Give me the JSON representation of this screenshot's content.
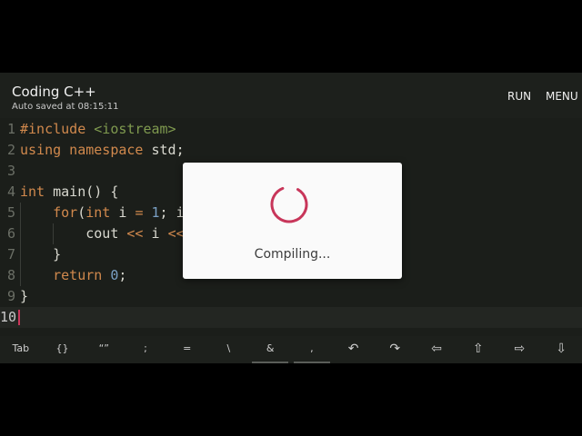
{
  "app": {
    "title": "Coding C++",
    "subtitle": "Auto saved at 08:15:11",
    "actions": {
      "run": "RUN",
      "menu": "MENU"
    }
  },
  "editor": {
    "line_numbers": [
      "1",
      "2",
      "3",
      "4",
      "5",
      "6",
      "7",
      "8",
      "9",
      "10"
    ],
    "lines": [
      [
        {
          "t": "#include ",
          "c": "directive"
        },
        {
          "t": "<iostream>",
          "c": "header"
        }
      ],
      [
        {
          "t": "using namespace ",
          "c": "kw"
        },
        {
          "t": "std;",
          "c": "plain"
        }
      ],
      [],
      [
        {
          "t": "int ",
          "c": "kw"
        },
        {
          "t": "main() {",
          "c": "plain"
        }
      ],
      [
        {
          "t": "    ",
          "c": "plain"
        },
        {
          "t": "for",
          "c": "kw"
        },
        {
          "t": "(",
          "c": "plain"
        },
        {
          "t": "int ",
          "c": "kw"
        },
        {
          "t": "i ",
          "c": "plain"
        },
        {
          "t": "= ",
          "c": "op"
        },
        {
          "t": "1",
          "c": "num"
        },
        {
          "t": "; i",
          "c": "plain"
        }
      ],
      [
        {
          "t": "        cout ",
          "c": "plain"
        },
        {
          "t": "<< ",
          "c": "op"
        },
        {
          "t": "i ",
          "c": "plain"
        },
        {
          "t": "<<",
          "c": "op"
        }
      ],
      [
        {
          "t": "    }",
          "c": "plain"
        }
      ],
      [
        {
          "t": "    ",
          "c": "plain"
        },
        {
          "t": "return ",
          "c": "kw"
        },
        {
          "t": "0",
          "c": "num"
        },
        {
          "t": ";",
          "c": "plain"
        }
      ],
      [
        {
          "t": "}",
          "c": "plain"
        }
      ],
      []
    ],
    "active_line": 10
  },
  "keybar": {
    "keys": [
      "Tab",
      "{}",
      "“”",
      ";",
      "=",
      "\\",
      "&",
      ",",
      "↶",
      "↷",
      "⇦",
      "⇧",
      "⇨",
      "⇩"
    ],
    "key_names": [
      "tab-key",
      "braces-key",
      "quotes-key",
      "semicolon-key",
      "equals-key",
      "backslash-key",
      "ampersand-key",
      "comma-key",
      "undo-icon",
      "redo-icon",
      "arrow-left-icon",
      "arrow-up-icon",
      "arrow-right-icon",
      "arrow-down-icon"
    ]
  },
  "dialog": {
    "message": "Compiling...",
    "spinner_icon": "progress-spinner-icon"
  },
  "colors": {
    "background": "#1b1e1a",
    "accent": "#c8365a",
    "keyword": "#d1894d",
    "string": "#7f9a4f",
    "number": "#7aa0c4"
  }
}
